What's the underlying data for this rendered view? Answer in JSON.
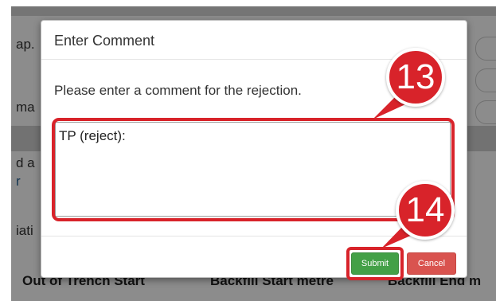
{
  "background": {
    "row1_fragment": "ap.",
    "row2_fragment": "ma",
    "row3_fragment": "d a",
    "row3_link_fragment": "r",
    "row4_fragment": "iati",
    "column_headers": [
      "Out of Trench Start",
      "Backfill Start metre",
      "Backfill End m"
    ]
  },
  "modal": {
    "title": "Enter Comment",
    "prompt": "Please enter a comment for the rejection.",
    "comment_value": "TP (reject):",
    "submit_label": "Submit",
    "cancel_label": "Cancel"
  },
  "callouts": {
    "step_13": "13",
    "step_14": "14"
  },
  "colors": {
    "callout_red": "#d8232a",
    "submit_green": "#43a047",
    "cancel_red": "#d9534f"
  }
}
